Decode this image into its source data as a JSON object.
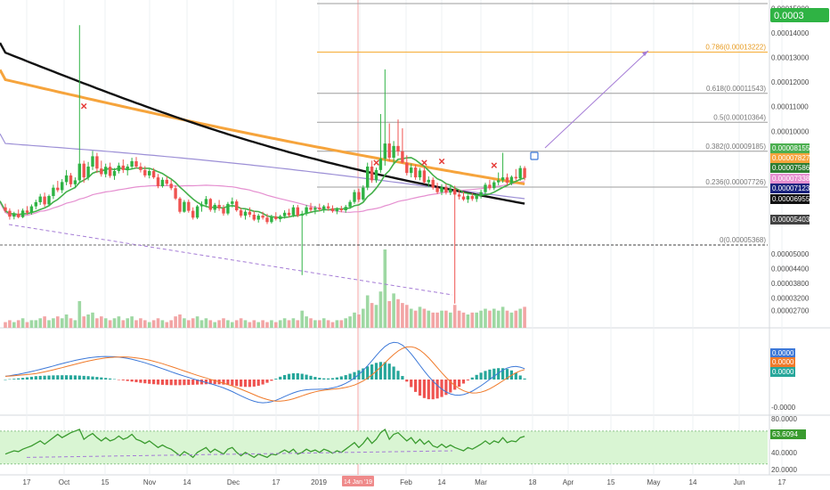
{
  "colors": {
    "bg": "#ffffff",
    "grid": "#eef0f3",
    "candle_up": "#26a69a",
    "candle_down": "#ef5350",
    "candle_up_green": "#2fb344",
    "ma_black": "#111111",
    "ma_orange": "#f6a43c",
    "ma_purple": "#9c8fd6",
    "ma_pink": "#e58fd0",
    "ma_green": "#43b04a",
    "fib_line": "#9e9e9e",
    "fib_orange": "#f7b54a",
    "vol_up": "#9ed8a3",
    "vol_down": "#f2a5a5",
    "macd_line": "#3c78d8",
    "signal_line": "#f07a2a",
    "rsi_line": "#3a9b2f",
    "rsi_fill": "#d9f5d3",
    "arrow": "#a57cd6",
    "marker_x": "#e53935",
    "session_line": "#f4a6a6"
  },
  "chart_data": [
    {
      "type": "candlestick",
      "panel": "price",
      "x_tick_labels": [
        "17",
        "Oct",
        "15",
        "Nov",
        "14",
        "Dec",
        "17",
        "2019",
        "14 Jan '19",
        "Feb",
        "14",
        "Mar",
        "18",
        "Apr",
        "15",
        "May",
        "14",
        "Jun",
        "17"
      ],
      "y_tick_labels": [
        "0.00015000",
        "0.00014000",
        "0.00013000",
        "0.00012000",
        "0.00011000",
        "0.00010000",
        "0.00009000",
        "0.00005000",
        "0.00004400",
        "0.00003800",
        "0.00003200",
        "0.00002700"
      ],
      "ylim": [
        2.1e-05,
        0.000152
      ],
      "current_price_label": "0.0003",
      "price_badges": [
        {
          "label": "0.00008155",
          "color": "#4caf50"
        },
        {
          "label": "0.00007827",
          "color": "#f6a43c"
        },
        {
          "label": "0.00007586",
          "color": "#2e7d32"
        },
        {
          "label": "0.00007338",
          "color": "#e58fd0"
        },
        {
          "label": "0.00007123",
          "color": "#1a237e"
        },
        {
          "label": "0.00006955",
          "color": "#111111"
        },
        {
          "label": "0.00005403",
          "color": "#424242"
        }
      ],
      "fib_levels": [
        {
          "label": "0.786(0.00013222)",
          "value": 0.00013222,
          "color": "#f7b54a"
        },
        {
          "label": "0.618(0.00011543)",
          "value": 0.00011543,
          "color": "#9e9e9e"
        },
        {
          "label": "0.5(0.00010364)",
          "value": 0.00010364,
          "color": "#9e9e9e"
        },
        {
          "label": "0.382(0.00009185)",
          "value": 9.185e-05,
          "color": "#9e9e9e"
        },
        {
          "label": "0.236(0.00007726)",
          "value": 7.726e-05,
          "color": "#9e9e9e"
        },
        {
          "label": "0(0.00005368)",
          "value": 5.368e-05,
          "color": "#424242"
        }
      ],
      "candles": [
        [
          6.9e-05,
          7.05e-05,
          6.68e-05,
          6.76e-05
        ],
        [
          6.76e-05,
          6.86e-05,
          6.4e-05,
          6.52e-05
        ],
        [
          6.52e-05,
          6.72e-05,
          6.41e-05,
          6.64e-05
        ],
        [
          6.64e-05,
          6.81e-05,
          6.45e-05,
          6.5e-05
        ],
        [
          6.5e-05,
          6.85e-05,
          6.46e-05,
          6.77e-05
        ],
        [
          6.77e-05,
          6.95e-05,
          6.6e-05,
          6.68e-05
        ],
        [
          6.68e-05,
          7.02e-05,
          6.6e-05,
          6.94e-05
        ],
        [
          6.94e-05,
          7.21e-05,
          6.82e-05,
          7.11e-05
        ],
        [
          7.11e-05,
          7.45e-05,
          7e-05,
          7.34e-05
        ],
        [
          7.34e-05,
          7.5e-05,
          6.92e-05,
          7.02e-05
        ],
        [
          7.02e-05,
          7.42e-05,
          6.95e-05,
          7.36e-05
        ],
        [
          7.36e-05,
          7.82e-05,
          7.24e-05,
          7.7e-05
        ],
        [
          7.7e-05,
          7.98e-05,
          7.52e-05,
          7.6e-05
        ],
        [
          7.6e-05,
          8.05e-05,
          7.48e-05,
          7.93e-05
        ],
        [
          7.93e-05,
          8.42e-05,
          7.8e-05,
          8.2e-05
        ],
        [
          8.2e-05,
          8.3e-05,
          7.72e-05,
          7.84e-05
        ],
        [
          7.84e-05,
          8.12e-05,
          7.68e-05,
          8e-05
        ],
        [
          8e-05,
          0.0001432,
          7.9e-05,
          8.68e-05
        ],
        [
          8.68e-05,
          8.8e-05,
          7.9e-05,
          8.12e-05
        ],
        [
          8.12e-05,
          8.75e-05,
          8e-05,
          8.56e-05
        ],
        [
          8.56e-05,
          9.2e-05,
          8.42e-05,
          8.98e-05
        ],
        [
          8.98e-05,
          9.12e-05,
          8.3e-05,
          8.48e-05
        ],
        [
          8.48e-05,
          8.8e-05,
          8.15e-05,
          8.25e-05
        ],
        [
          8.25e-05,
          8.68e-05,
          8.12e-05,
          8.55e-05
        ],
        [
          8.55e-05,
          8.72e-05,
          8.1e-05,
          8.18e-05
        ],
        [
          8.18e-05,
          8.5e-05,
          8.02e-05,
          8.38e-05
        ],
        [
          8.38e-05,
          8.72e-05,
          8.28e-05,
          8.6e-05
        ],
        [
          8.6e-05,
          8.85e-05,
          8.3e-05,
          8.42e-05
        ],
        [
          8.42e-05,
          8.66e-05,
          8.2e-05,
          8.56e-05
        ],
        [
          8.56e-05,
          8.92e-05,
          8.45e-05,
          8.78e-05
        ],
        [
          8.78e-05,
          8.95e-05,
          8.48e-05,
          8.56e-05
        ],
        [
          8.56e-05,
          8.72e-05,
          8.32e-05,
          8.42e-05
        ],
        [
          8.42e-05,
          8.58e-05,
          8.12e-05,
          8.2e-05
        ],
        [
          8.2e-05,
          8.46e-05,
          8.08e-05,
          8.38e-05
        ],
        [
          8.38e-05,
          8.5e-05,
          8.06e-05,
          8.12e-05
        ],
        [
          8.12e-05,
          8.26e-05,
          7.68e-05,
          7.76e-05
        ],
        [
          7.76e-05,
          8.12e-05,
          7.7e-05,
          8.02e-05
        ],
        [
          8.02e-05,
          8.16e-05,
          7.78e-05,
          7.86e-05
        ],
        [
          7.86e-05,
          8.02e-05,
          7.6e-05,
          7.68e-05
        ],
        [
          7.68e-05,
          7.8e-05,
          7.2e-05,
          7.26e-05
        ],
        [
          7.26e-05,
          7.32e-05,
          6.65e-05,
          6.72e-05
        ],
        [
          6.72e-05,
          7.2e-05,
          6.68e-05,
          7.12e-05
        ],
        [
          7.12e-05,
          7.22e-05,
          6.68e-05,
          6.76e-05
        ],
        [
          6.76e-05,
          6.9e-05,
          6.4e-05,
          6.48e-05
        ],
        [
          6.48e-05,
          7e-05,
          6.42e-05,
          6.94e-05
        ],
        [
          6.94e-05,
          7.14e-05,
          6.72e-05,
          7.02e-05
        ],
        [
          7.02e-05,
          7.36e-05,
          6.9e-05,
          7.24e-05
        ],
        [
          7.24e-05,
          7.28e-05,
          6.72e-05,
          6.8e-05
        ],
        [
          6.8e-05,
          7.08e-05,
          6.68e-05,
          7e-05
        ],
        [
          7e-05,
          7.2e-05,
          6.76e-05,
          6.86e-05
        ],
        [
          6.86e-05,
          7e-05,
          6.56e-05,
          6.65e-05
        ],
        [
          6.65e-05,
          7.12e-05,
          6.58e-05,
          7.04e-05
        ],
        [
          7.04e-05,
          7.3e-05,
          6.9e-05,
          7.14e-05
        ],
        [
          7.14e-05,
          7.22e-05,
          6.72e-05,
          6.78e-05
        ],
        [
          6.78e-05,
          6.88e-05,
          6.48e-05,
          6.56e-05
        ],
        [
          6.56e-05,
          6.8e-05,
          6.4e-05,
          6.72e-05
        ],
        [
          6.72e-05,
          6.9e-05,
          6.5e-05,
          6.6e-05
        ],
        [
          6.6e-05,
          6.76e-05,
          6.34e-05,
          6.4e-05
        ],
        [
          6.4e-05,
          6.64e-05,
          6.28e-05,
          6.56e-05
        ],
        [
          6.56e-05,
          6.72e-05,
          6.4e-05,
          6.48e-05
        ],
        [
          6.48e-05,
          6.64e-05,
          6.22e-05,
          6.3e-05
        ],
        [
          6.3e-05,
          6.6e-05,
          6.24e-05,
          6.52e-05
        ],
        [
          6.52e-05,
          6.7e-05,
          6.36e-05,
          6.42e-05
        ],
        [
          6.42e-05,
          6.6e-05,
          6.3e-05,
          6.54e-05
        ],
        [
          6.54e-05,
          6.78e-05,
          6.44e-05,
          6.68e-05
        ],
        [
          6.68e-05,
          6.84e-05,
          6.5e-05,
          6.58e-05
        ],
        [
          6.58e-05,
          7e-05,
          6.5e-05,
          6.9e-05
        ],
        [
          6.9e-05,
          7e-05,
          6.5e-05,
          6.56e-05
        ],
        [
          6.56e-05,
          6.76e-05,
          4.14e-05,
          6.64e-05
        ],
        [
          6.64e-05,
          7e-05,
          6.55e-05,
          6.9e-05
        ],
        [
          6.9e-05,
          7.08e-05,
          6.72e-05,
          6.8e-05
        ],
        [
          6.8e-05,
          6.96e-05,
          6.62e-05,
          6.88e-05
        ],
        [
          6.88e-05,
          7.05e-05,
          6.74e-05,
          6.82e-05
        ],
        [
          6.82e-05,
          7e-05,
          6.68e-05,
          6.94e-05
        ],
        [
          6.94e-05,
          7.08e-05,
          6.76e-05,
          6.86e-05
        ],
        [
          6.86e-05,
          6.98e-05,
          6.68e-05,
          6.74e-05
        ],
        [
          6.74e-05,
          6.9e-05,
          6.62e-05,
          6.84e-05
        ],
        [
          6.84e-05,
          6.96e-05,
          6.7e-05,
          6.78e-05
        ],
        [
          6.78e-05,
          7e-05,
          6.68e-05,
          6.92e-05
        ],
        [
          6.92e-05,
          7.2e-05,
          6.84e-05,
          7.12e-05
        ],
        [
          7.12e-05,
          7.62e-05,
          7.04e-05,
          7.52e-05
        ],
        [
          7.52e-05,
          7.66e-05,
          7.12e-05,
          7.22e-05
        ],
        [
          7.22e-05,
          7.8e-05,
          7.16e-05,
          7.7e-05
        ],
        [
          7.7e-05,
          8.72e-05,
          7.6e-05,
          8.56e-05
        ],
        [
          8.56e-05,
          8.8e-05,
          7.9e-05,
          8e-05
        ],
        [
          8e-05,
          8.52e-05,
          7.9e-05,
          8.42e-05
        ],
        [
          8.42e-05,
          0.000107,
          8.3e-05,
          8.88e-05
        ],
        [
          8.88e-05,
          0.0001252,
          8.6e-05,
          9.5e-05
        ],
        [
          9.5e-05,
          0.0001032,
          8.78e-05,
          8.92e-05
        ],
        [
          8.92e-05,
          9.6e-05,
          8.7e-05,
          9.4e-05
        ],
        [
          9.4e-05,
          0.0001048,
          9e-05,
          9.18e-05
        ],
        [
          9.18e-05,
          0.0001012,
          8.68e-05,
          8.72e-05
        ],
        [
          8.72e-05,
          9.02e-05,
          8.2e-05,
          8.3e-05
        ],
        [
          8.3e-05,
          8.68e-05,
          8.12e-05,
          8.52e-05
        ],
        [
          8.52e-05,
          8.64e-05,
          8.02e-05,
          8.12e-05
        ],
        [
          8.12e-05,
          8.5e-05,
          8e-05,
          8.4e-05
        ],
        [
          8.4e-05,
          8.52e-05,
          7.86e-05,
          7.92e-05
        ],
        [
          7.92e-05,
          8.16e-05,
          7.72e-05,
          8.02e-05
        ],
        [
          8.02e-05,
          8.12e-05,
          7.62e-05,
          7.7e-05
        ],
        [
          7.7e-05,
          7.9e-05,
          7.44e-05,
          7.52e-05
        ],
        [
          7.52e-05,
          7.84e-05,
          7.4e-05,
          7.72e-05
        ],
        [
          7.72e-05,
          7.86e-05,
          7.42e-05,
          7.5e-05
        ],
        [
          7.5e-05,
          7.8e-05,
          7.4e-05,
          7.64e-05
        ],
        [
          7.64e-05,
          7.78e-05,
          2.98e-05,
          7.42e-05
        ],
        [
          7.42e-05,
          7.62e-05,
          7.22e-05,
          7.34e-05
        ],
        [
          7.34e-05,
          7.54e-05,
          7.16e-05,
          7.22e-05
        ],
        [
          7.22e-05,
          7.42e-05,
          7.08e-05,
          7.36e-05
        ],
        [
          7.36e-05,
          7.48e-05,
          7.16e-05,
          7.24e-05
        ],
        [
          7.24e-05,
          7.46e-05,
          7.12e-05,
          7.38e-05
        ],
        [
          7.38e-05,
          7.62e-05,
          7.26e-05,
          7.52e-05
        ],
        [
          7.52e-05,
          7.9e-05,
          7.4e-05,
          7.82e-05
        ],
        [
          7.82e-05,
          8.02e-05,
          7.6e-05,
          7.68e-05
        ],
        [
          7.68e-05,
          8e-05,
          7.6e-05,
          7.92e-05
        ],
        [
          7.92e-05,
          8.32e-05,
          7.8e-05,
          8e-05
        ],
        [
          8e-05,
          9.12e-05,
          7.9e-05,
          8.12e-05
        ],
        [
          8.12e-05,
          8.28e-05,
          7.8e-05,
          7.9e-05
        ],
        [
          7.9e-05,
          8.2e-05,
          7.8e-05,
          8.14e-05
        ],
        [
          8.14e-05,
          8.46e-05,
          7.98e-05,
          8.08e-05
        ],
        [
          8.08e-05,
          8.6e-05,
          7.98e-05,
          8.5e-05
        ],
        [
          8.5e-05,
          8.58e-05,
          8e-05,
          8.1e-05
        ]
      ],
      "volume": [
        3,
        4,
        3,
        4,
        5,
        3,
        4,
        4,
        5,
        6,
        4,
        5,
        6,
        5,
        7,
        5,
        4,
        14,
        6,
        7,
        8,
        5,
        6,
        5,
        4,
        5,
        6,
        4,
        5,
        6,
        4,
        5,
        4,
        3,
        4,
        5,
        4,
        3,
        4,
        6,
        7,
        5,
        4,
        5,
        6,
        4,
        5,
        4,
        3,
        4,
        5,
        4,
        3,
        4,
        5,
        4,
        3,
        4,
        3,
        4,
        3,
        4,
        3,
        4,
        5,
        4,
        5,
        4,
        9,
        6,
        5,
        4,
        4,
        5,
        4,
        3,
        4,
        4,
        5,
        6,
        8,
        7,
        10,
        17,
        13,
        12,
        19,
        41,
        14,
        18,
        15,
        13,
        12,
        10,
        9,
        11,
        10,
        9,
        8,
        8,
        9,
        9,
        8,
        12,
        9,
        8,
        7,
        8,
        8,
        9,
        10,
        9,
        10,
        9,
        11,
        9,
        8,
        9,
        10,
        11
      ],
      "moving_averages": [
        {
          "period": 200,
          "color": "#111111"
        },
        {
          "period": 100,
          "color": "#f6a43c"
        },
        {
          "period": 60,
          "color": "#9c8fd6"
        },
        {
          "period": 40,
          "color": "#e58fd0"
        },
        {
          "period": 10,
          "color": "#43b04a"
        }
      ],
      "annotations": [
        "×",
        "↗"
      ]
    },
    {
      "type": "bar",
      "panel": "macd",
      "y_tick_labels": [
        "0.0000",
        "0.0000",
        "0.0000",
        "-0.0000"
      ],
      "series": [
        {
          "name": "",
          "type": "histogram"
        },
        {
          "name": "",
          "type": "line",
          "color": "#3c78d8"
        },
        {
          "name": "",
          "type": "line",
          "color": "#f07a2a"
        }
      ]
    },
    {
      "type": "line",
      "panel": "rsi",
      "y_tick_labels": [
        "80.0000",
        "40.0000",
        "20.0000"
      ],
      "current_value_label": "63.6094",
      "values": [
        42,
        44,
        46,
        45,
        48,
        50,
        52,
        55,
        58,
        54,
        58,
        62,
        66,
        62,
        65,
        68,
        70,
        72,
        60,
        64,
        67,
        62,
        58,
        62,
        58,
        60,
        64,
        60,
        62,
        66,
        60,
        58,
        55,
        58,
        54,
        50,
        53,
        50,
        48,
        44,
        40,
        45,
        42,
        38,
        44,
        47,
        50,
        44,
        48,
        45,
        42,
        48,
        50,
        44,
        40,
        44,
        41,
        38,
        42,
        40,
        38,
        42,
        41,
        44,
        47,
        44,
        48,
        42,
        44,
        48,
        45,
        47,
        44,
        48,
        46,
        43,
        46,
        44,
        48,
        52,
        56,
        50,
        55,
        62,
        55,
        60,
        68,
        72,
        60,
        66,
        68,
        63,
        58,
        62,
        55,
        60,
        54,
        58,
        52,
        50,
        54,
        50,
        53,
        50,
        48,
        46,
        50,
        48,
        51,
        54,
        58,
        54,
        58,
        56,
        62,
        56,
        58,
        57,
        62,
        63.6
      ]
    }
  ]
}
